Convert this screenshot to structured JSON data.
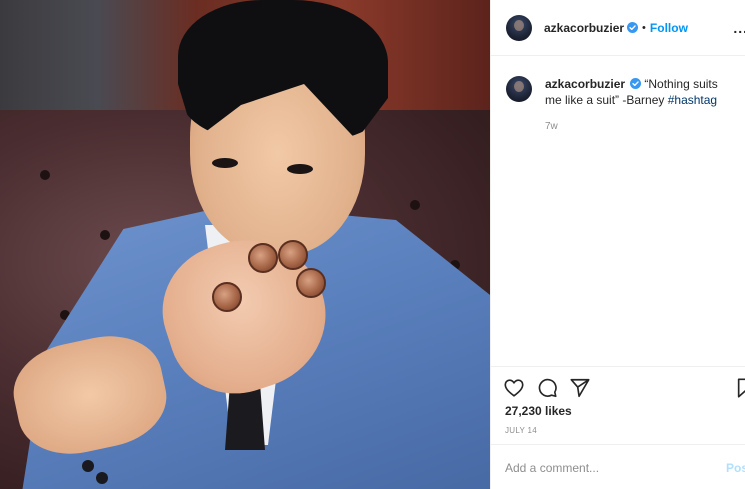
{
  "post": {
    "image_alt": "",
    "author": {
      "username": "azkacorbuzier",
      "verified": true,
      "avatar_icon": "profile-avatar"
    },
    "header": {
      "dot": "•",
      "follow_label": "Follow",
      "more_label": "..."
    },
    "caption": {
      "text": "“Nothing suits me like a suit” -Barney ",
      "hashtag": "#hashtag",
      "age": "7w"
    },
    "actions": {
      "like_icon": "heart-icon",
      "comment_icon": "comment-icon",
      "share_icon": "share-icon",
      "save_icon": "bookmark-icon"
    },
    "likes": "27,230 likes",
    "date": "JULY 14",
    "comment": {
      "placeholder": "Add a comment...",
      "post_label": "Pos"
    },
    "colors": {
      "accent": "#0095f6",
      "hashtag": "#00376b",
      "muted": "#8e8e8e",
      "post_disabled": "#b2dffc",
      "verified": "#3897f0"
    }
  }
}
